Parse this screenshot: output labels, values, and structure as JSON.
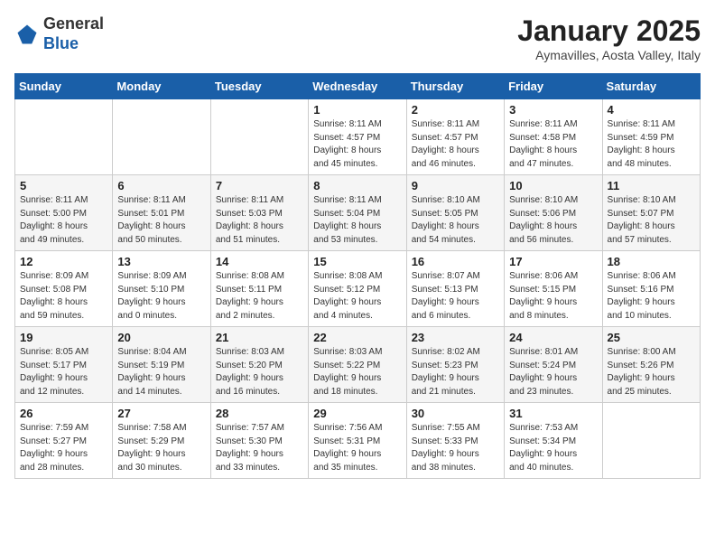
{
  "header": {
    "logo_general": "General",
    "logo_blue": "Blue",
    "month_title": "January 2025",
    "subtitle": "Aymavilles, Aosta Valley, Italy"
  },
  "days_of_week": [
    "Sunday",
    "Monday",
    "Tuesday",
    "Wednesday",
    "Thursday",
    "Friday",
    "Saturday"
  ],
  "weeks": [
    [
      {
        "day": "",
        "info": ""
      },
      {
        "day": "",
        "info": ""
      },
      {
        "day": "",
        "info": ""
      },
      {
        "day": "1",
        "info": "Sunrise: 8:11 AM\nSunset: 4:57 PM\nDaylight: 8 hours\nand 45 minutes."
      },
      {
        "day": "2",
        "info": "Sunrise: 8:11 AM\nSunset: 4:57 PM\nDaylight: 8 hours\nand 46 minutes."
      },
      {
        "day": "3",
        "info": "Sunrise: 8:11 AM\nSunset: 4:58 PM\nDaylight: 8 hours\nand 47 minutes."
      },
      {
        "day": "4",
        "info": "Sunrise: 8:11 AM\nSunset: 4:59 PM\nDaylight: 8 hours\nand 48 minutes."
      }
    ],
    [
      {
        "day": "5",
        "info": "Sunrise: 8:11 AM\nSunset: 5:00 PM\nDaylight: 8 hours\nand 49 minutes."
      },
      {
        "day": "6",
        "info": "Sunrise: 8:11 AM\nSunset: 5:01 PM\nDaylight: 8 hours\nand 50 minutes."
      },
      {
        "day": "7",
        "info": "Sunrise: 8:11 AM\nSunset: 5:03 PM\nDaylight: 8 hours\nand 51 minutes."
      },
      {
        "day": "8",
        "info": "Sunrise: 8:11 AM\nSunset: 5:04 PM\nDaylight: 8 hours\nand 53 minutes."
      },
      {
        "day": "9",
        "info": "Sunrise: 8:10 AM\nSunset: 5:05 PM\nDaylight: 8 hours\nand 54 minutes."
      },
      {
        "day": "10",
        "info": "Sunrise: 8:10 AM\nSunset: 5:06 PM\nDaylight: 8 hours\nand 56 minutes."
      },
      {
        "day": "11",
        "info": "Sunrise: 8:10 AM\nSunset: 5:07 PM\nDaylight: 8 hours\nand 57 minutes."
      }
    ],
    [
      {
        "day": "12",
        "info": "Sunrise: 8:09 AM\nSunset: 5:08 PM\nDaylight: 8 hours\nand 59 minutes."
      },
      {
        "day": "13",
        "info": "Sunrise: 8:09 AM\nSunset: 5:10 PM\nDaylight: 9 hours\nand 0 minutes."
      },
      {
        "day": "14",
        "info": "Sunrise: 8:08 AM\nSunset: 5:11 PM\nDaylight: 9 hours\nand 2 minutes."
      },
      {
        "day": "15",
        "info": "Sunrise: 8:08 AM\nSunset: 5:12 PM\nDaylight: 9 hours\nand 4 minutes."
      },
      {
        "day": "16",
        "info": "Sunrise: 8:07 AM\nSunset: 5:13 PM\nDaylight: 9 hours\nand 6 minutes."
      },
      {
        "day": "17",
        "info": "Sunrise: 8:06 AM\nSunset: 5:15 PM\nDaylight: 9 hours\nand 8 minutes."
      },
      {
        "day": "18",
        "info": "Sunrise: 8:06 AM\nSunset: 5:16 PM\nDaylight: 9 hours\nand 10 minutes."
      }
    ],
    [
      {
        "day": "19",
        "info": "Sunrise: 8:05 AM\nSunset: 5:17 PM\nDaylight: 9 hours\nand 12 minutes."
      },
      {
        "day": "20",
        "info": "Sunrise: 8:04 AM\nSunset: 5:19 PM\nDaylight: 9 hours\nand 14 minutes."
      },
      {
        "day": "21",
        "info": "Sunrise: 8:03 AM\nSunset: 5:20 PM\nDaylight: 9 hours\nand 16 minutes."
      },
      {
        "day": "22",
        "info": "Sunrise: 8:03 AM\nSunset: 5:22 PM\nDaylight: 9 hours\nand 18 minutes."
      },
      {
        "day": "23",
        "info": "Sunrise: 8:02 AM\nSunset: 5:23 PM\nDaylight: 9 hours\nand 21 minutes."
      },
      {
        "day": "24",
        "info": "Sunrise: 8:01 AM\nSunset: 5:24 PM\nDaylight: 9 hours\nand 23 minutes."
      },
      {
        "day": "25",
        "info": "Sunrise: 8:00 AM\nSunset: 5:26 PM\nDaylight: 9 hours\nand 25 minutes."
      }
    ],
    [
      {
        "day": "26",
        "info": "Sunrise: 7:59 AM\nSunset: 5:27 PM\nDaylight: 9 hours\nand 28 minutes."
      },
      {
        "day": "27",
        "info": "Sunrise: 7:58 AM\nSunset: 5:29 PM\nDaylight: 9 hours\nand 30 minutes."
      },
      {
        "day": "28",
        "info": "Sunrise: 7:57 AM\nSunset: 5:30 PM\nDaylight: 9 hours\nand 33 minutes."
      },
      {
        "day": "29",
        "info": "Sunrise: 7:56 AM\nSunset: 5:31 PM\nDaylight: 9 hours\nand 35 minutes."
      },
      {
        "day": "30",
        "info": "Sunrise: 7:55 AM\nSunset: 5:33 PM\nDaylight: 9 hours\nand 38 minutes."
      },
      {
        "day": "31",
        "info": "Sunrise: 7:53 AM\nSunset: 5:34 PM\nDaylight: 9 hours\nand 40 minutes."
      },
      {
        "day": "",
        "info": ""
      }
    ]
  ]
}
